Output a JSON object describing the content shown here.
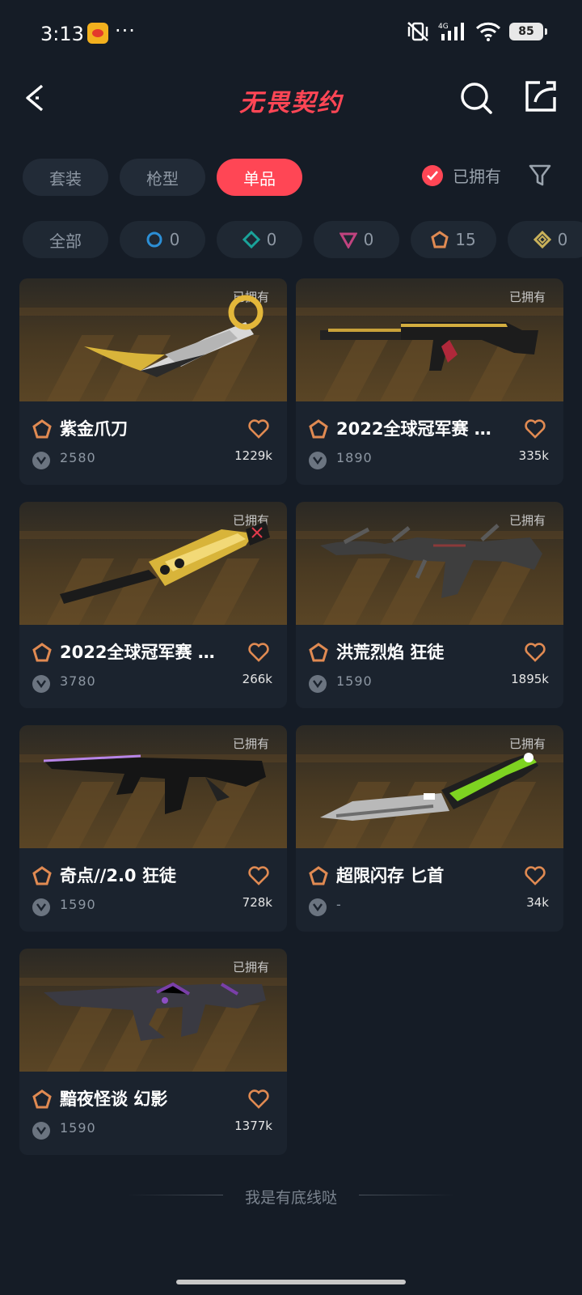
{
  "status_bar": {
    "time": "3:13",
    "dots": "···",
    "battery": "85",
    "network": "4G"
  },
  "header": {
    "title": "无畏契约"
  },
  "tabs": [
    {
      "label": "套装",
      "active": false
    },
    {
      "label": "枪型",
      "active": false
    },
    {
      "label": "单品",
      "active": true
    }
  ],
  "owned_filter": {
    "label": "已拥有",
    "checked": true
  },
  "rarity_filters": [
    {
      "label": "全部",
      "icon": "none"
    },
    {
      "label": "0",
      "icon": "select-tier-icon",
      "color": "#2c8fd6"
    },
    {
      "label": "0",
      "icon": "deluxe-tier-icon",
      "color": "#1aa39a"
    },
    {
      "label": "0",
      "icon": "premium-tier-icon",
      "color": "#c1437f"
    },
    {
      "label": "15",
      "icon": "exclusive-tier-icon",
      "color": "#e08a52"
    },
    {
      "label": "0",
      "icon": "ultra-tier-icon",
      "color": "#c9b15a"
    }
  ],
  "cards": [
    {
      "name": "紫金爪刀",
      "price": "2580",
      "likes": "1229k",
      "owned_label": "已拥有",
      "tier_color": "#e08a52"
    },
    {
      "name": "2022全球冠军赛 …",
      "price": "1890",
      "likes": "335k",
      "owned_label": "已拥有",
      "tier_color": "#e08a52"
    },
    {
      "name": "2022全球冠军赛 …",
      "price": "3780",
      "likes": "266k",
      "owned_label": "已拥有",
      "tier_color": "#e08a52"
    },
    {
      "name": "洪荒烈焰 狂徒",
      "price": "1590",
      "likes": "1895k",
      "owned_label": "已拥有",
      "tier_color": "#e08a52"
    },
    {
      "name": "奇点//2.0 狂徒",
      "price": "1590",
      "likes": "728k",
      "owned_label": "已拥有",
      "tier_color": "#e08a52"
    },
    {
      "name": "超限闪存 匕首",
      "price": "-",
      "likes": "34k",
      "owned_label": "已拥有",
      "tier_color": "#e08a52"
    },
    {
      "name": "黯夜怪谈 幻影",
      "price": "1590",
      "likes": "1377k",
      "owned_label": "已拥有",
      "tier_color": "#e08a52"
    }
  ],
  "footer": {
    "text": "我是有底线哒"
  },
  "colors": {
    "accent": "#ff4655",
    "background": "#151c26",
    "card": "#1b232e"
  }
}
